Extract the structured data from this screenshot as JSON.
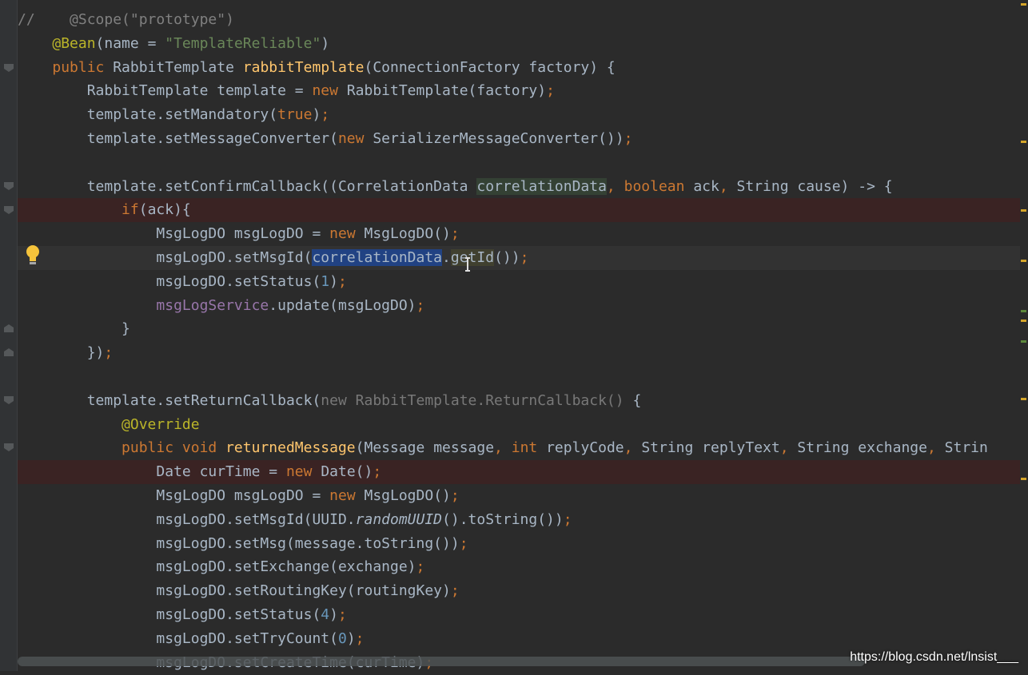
{
  "editor": {
    "lines": [
      {
        "tokens": [
          {
            "t": "//    @Scope(\"prototype\")",
            "c": "cmt"
          }
        ]
      },
      {
        "tokens": [
          {
            "t": "    "
          },
          {
            "t": "@Bean",
            "c": "ann"
          },
          {
            "t": "(name = "
          },
          {
            "t": "\"TemplateReliable\"",
            "c": "str"
          },
          {
            "t": ")"
          }
        ]
      },
      {
        "tokens": [
          {
            "t": "    "
          },
          {
            "t": "public ",
            "c": "kw"
          },
          {
            "t": "RabbitTemplate "
          },
          {
            "t": "rabbitTemplate",
            "c": "fn"
          },
          {
            "t": "(ConnectionFactory factory) {"
          }
        ]
      },
      {
        "tokens": [
          {
            "t": "        RabbitTemplate template = "
          },
          {
            "t": "new ",
            "c": "kw"
          },
          {
            "t": "RabbitTemplate(factory)"
          },
          {
            "t": ";",
            "c": "kw"
          }
        ]
      },
      {
        "tokens": [
          {
            "t": "        template.setMandatory("
          },
          {
            "t": "true",
            "c": "kw"
          },
          {
            "t": ")"
          },
          {
            "t": ";",
            "c": "kw"
          }
        ]
      },
      {
        "tokens": [
          {
            "t": "        template.setMessageConverter("
          },
          {
            "t": "new ",
            "c": "kw"
          },
          {
            "t": "SerializerMessageConverter())"
          },
          {
            "t": ";",
            "c": "kw"
          }
        ]
      },
      {
        "tokens": [
          {
            "t": ""
          }
        ]
      },
      {
        "tokens": [
          {
            "t": "        template.setConfirmCallback((CorrelationData "
          },
          {
            "t": "correlationData",
            "c": "hl-read"
          },
          {
            "t": ", ",
            "c": "kw"
          },
          {
            "t": "boolean ",
            "c": "kw"
          },
          {
            "t": "ack"
          },
          {
            "t": ", ",
            "c": "kw"
          },
          {
            "t": "String cause) -> {"
          }
        ]
      },
      {
        "tokens": [
          {
            "t": "            "
          },
          {
            "t": "if",
            "c": "kw"
          },
          {
            "t": "(ack){"
          }
        ]
      },
      {
        "tokens": [
          {
            "t": "                MsgLogDO msgLogDO = "
          },
          {
            "t": "new ",
            "c": "kw"
          },
          {
            "t": "MsgLogDO()"
          },
          {
            "t": ";",
            "c": "kw"
          }
        ]
      },
      {
        "tokens": [
          {
            "t": "                msgLogDO.setMsgId("
          },
          {
            "t": "correlationData",
            "c": "hl-sel"
          },
          {
            "t": "."
          },
          {
            "t": "getId",
            "c": "hl-use"
          },
          {
            "t": "())"
          },
          {
            "t": ";",
            "c": "kw"
          }
        ]
      },
      {
        "tokens": [
          {
            "t": "                msgLogDO.setStatus("
          },
          {
            "t": "1",
            "c": "num"
          },
          {
            "t": ")"
          },
          {
            "t": ";",
            "c": "kw"
          }
        ]
      },
      {
        "tokens": [
          {
            "t": "                "
          },
          {
            "t": "msgLogService",
            "c": "fld"
          },
          {
            "t": ".update(msgLogDO)"
          },
          {
            "t": ";",
            "c": "kw"
          }
        ]
      },
      {
        "tokens": [
          {
            "t": "            }"
          }
        ]
      },
      {
        "tokens": [
          {
            "t": "        })"
          },
          {
            "t": ";",
            "c": "kw"
          }
        ]
      },
      {
        "tokens": [
          {
            "t": ""
          }
        ]
      },
      {
        "tokens": [
          {
            "t": "        template.setReturnCallback("
          },
          {
            "t": "new RabbitTemplate.ReturnCallback() ",
            "c": "dim"
          },
          {
            "t": "{"
          }
        ]
      },
      {
        "tokens": [
          {
            "t": "            "
          },
          {
            "t": "@Override",
            "c": "ann"
          }
        ]
      },
      {
        "tokens": [
          {
            "t": "            "
          },
          {
            "t": "public void ",
            "c": "kw"
          },
          {
            "t": "returnedMessage",
            "c": "fn"
          },
          {
            "t": "(Message message"
          },
          {
            "t": ", ",
            "c": "kw"
          },
          {
            "t": "int ",
            "c": "kw"
          },
          {
            "t": "replyCode"
          },
          {
            "t": ", ",
            "c": "kw"
          },
          {
            "t": "String replyText"
          },
          {
            "t": ", ",
            "c": "kw"
          },
          {
            "t": "String exchange"
          },
          {
            "t": ", ",
            "c": "kw"
          },
          {
            "t": "Strin"
          }
        ]
      },
      {
        "tokens": [
          {
            "t": "                Date curTime = "
          },
          {
            "t": "new ",
            "c": "kw"
          },
          {
            "t": "Date()"
          },
          {
            "t": ";",
            "c": "kw"
          }
        ]
      },
      {
        "tokens": [
          {
            "t": "                MsgLogDO msgLogDO = "
          },
          {
            "t": "new ",
            "c": "kw"
          },
          {
            "t": "MsgLogDO()"
          },
          {
            "t": ";",
            "c": "kw"
          }
        ]
      },
      {
        "tokens": [
          {
            "t": "                msgLogDO.setMsgId(UUID."
          },
          {
            "t": "randomUUID",
            "c": "it"
          },
          {
            "t": "().toString())"
          },
          {
            "t": ";",
            "c": "kw"
          }
        ]
      },
      {
        "tokens": [
          {
            "t": "                msgLogDO.setMsg(message.toString())"
          },
          {
            "t": ";",
            "c": "kw"
          }
        ]
      },
      {
        "tokens": [
          {
            "t": "                msgLogDO.setExchange(exchange)"
          },
          {
            "t": ";",
            "c": "kw"
          }
        ]
      },
      {
        "tokens": [
          {
            "t": "                msgLogDO.setRoutingKey(routingKey)"
          },
          {
            "t": ";",
            "c": "kw"
          }
        ]
      },
      {
        "tokens": [
          {
            "t": "                msgLogDO.setStatus("
          },
          {
            "t": "4",
            "c": "num"
          },
          {
            "t": ")"
          },
          {
            "t": ";",
            "c": "kw"
          }
        ]
      },
      {
        "tokens": [
          {
            "t": "                msgLogDO.setTryCount("
          },
          {
            "t": "0",
            "c": "num"
          },
          {
            "t": ")"
          },
          {
            "t": ";",
            "c": "kw"
          }
        ]
      },
      {
        "tokens": [
          {
            "t": "                msgLogDO.setCreateTime(curTime)"
          },
          {
            "t": ";",
            "c": "kw"
          }
        ]
      }
    ]
  },
  "intention_icon": "lightbulb-icon",
  "watermark": "https://blog.csdn.net/lnsist___"
}
